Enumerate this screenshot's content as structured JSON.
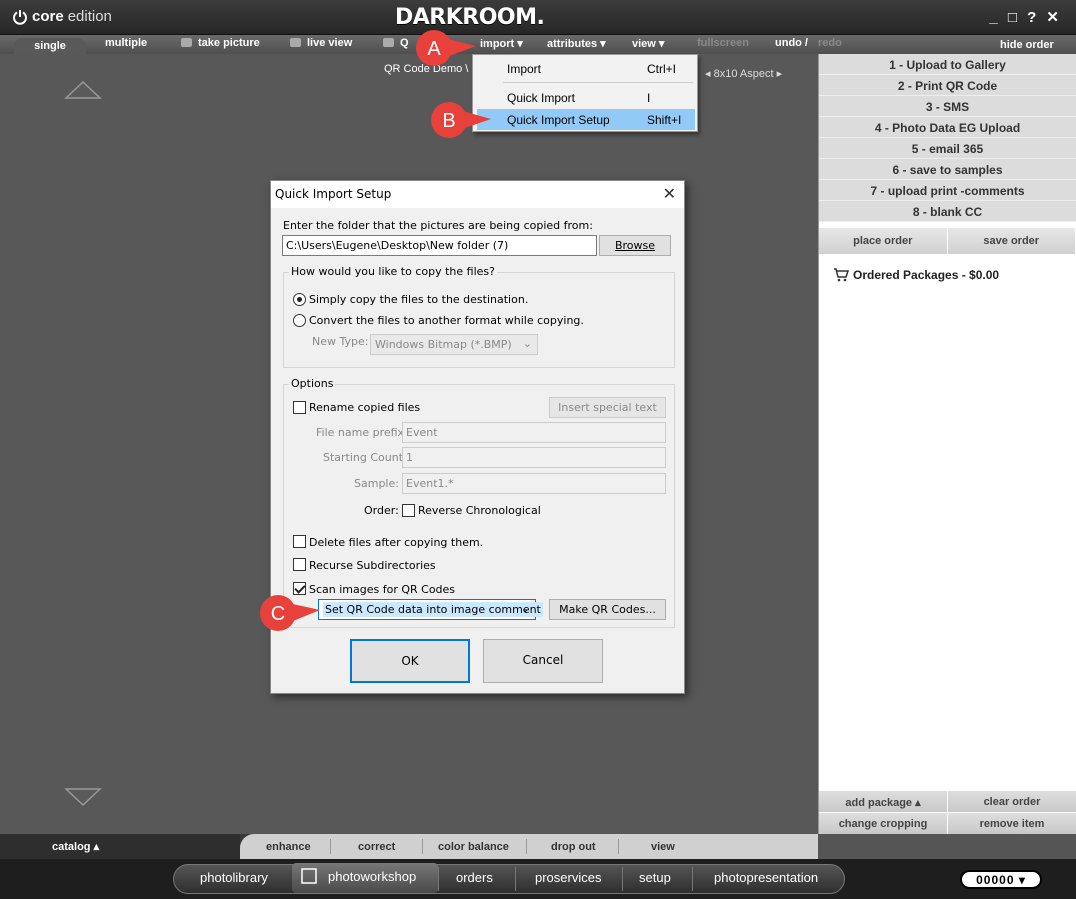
{
  "brand": {
    "core": "core",
    "edition": "edition"
  },
  "app_title": "DARKROOM.",
  "window_controls": "_ □ ? ✕",
  "toolbar": {
    "single": "single",
    "multiple": "multiple",
    "take_picture": "take picture",
    "live_view": "live view",
    "qr": "Q",
    "import": "import ▾",
    "attributes": "attributes ▾",
    "view": "view ▾",
    "fullscreen": "fullscreen",
    "undo": "undo /",
    "redo": "redo",
    "hide_order": "hide order"
  },
  "canvas": {
    "caption": "QR Code Demo \\ 191",
    "aspect": "◂  8x10  Aspect  ▸"
  },
  "import_menu": {
    "items": [
      {
        "label": "Import",
        "shortcut": "Ctrl+I"
      },
      {
        "label": "Quick Import",
        "shortcut": "I"
      },
      {
        "label": "Quick Import Setup",
        "shortcut": "Shift+I"
      }
    ]
  },
  "callouts": {
    "a": "A",
    "b": "B",
    "c": "C",
    "color": "#e8403a"
  },
  "dialog": {
    "title": "Quick Import Setup",
    "folder_label": "Enter the folder that the pictures are being copied from:",
    "folder_value": "C:\\Users\\Eugene\\Desktop\\New folder (7)",
    "browse": "Browse",
    "copy_group": "How would you like to copy the files?",
    "radio_simple": "Simply copy the files to the destination.",
    "radio_convert": "Convert the files to another format while copying.",
    "new_type_label": "New Type:",
    "new_type_value": "Windows Bitmap (*.BMP)",
    "options_group": "Options",
    "rename": "Rename copied files",
    "insert_special": "Insert special text",
    "prefix_label": "File name prefix:",
    "prefix_value": "Event",
    "start_label": "Starting Count:",
    "start_value": "1",
    "sample_label": "Sample:",
    "sample_value": "Event1.*",
    "order_label": "Order:",
    "reverse": "Reverse Chronological",
    "delete": "Delete files after copying them.",
    "recurse": "Recurse Subdirectories",
    "scan": "Scan images for QR Codes",
    "qr_option": "Set QR Code data into image comment",
    "make_qr": "Make QR Codes...",
    "ok": "OK",
    "cancel": "Cancel"
  },
  "right_panel": {
    "presets": [
      "1 - Upload to Gallery",
      "2 - Print QR Code",
      "3 - SMS",
      "4 - Photo Data EG Upload",
      "5 - email 365",
      "6 - save to samples",
      "7 - upload print -comments",
      "8 - blank CC"
    ],
    "place_order": "place order",
    "save_order": "save order",
    "ordered_packages": "Ordered Packages - $0.00",
    "add_package": "add package ▴",
    "clear_order": "clear order",
    "change_cropping": "change cropping",
    "remove_item": "remove item"
  },
  "bottom_tabs": {
    "catalog": "catalog ▴",
    "enhance": "enhance",
    "correct": "correct",
    "color_balance": "color balance",
    "drop_out": "drop out",
    "view": "view"
  },
  "footer": {
    "photolibrary": "photolibrary",
    "photoworkshop": "photoworkshop",
    "orders": "orders",
    "proservices": "proservices",
    "setup": "setup",
    "photopresentation": "photopresentation",
    "counter": "00000 ▾"
  }
}
